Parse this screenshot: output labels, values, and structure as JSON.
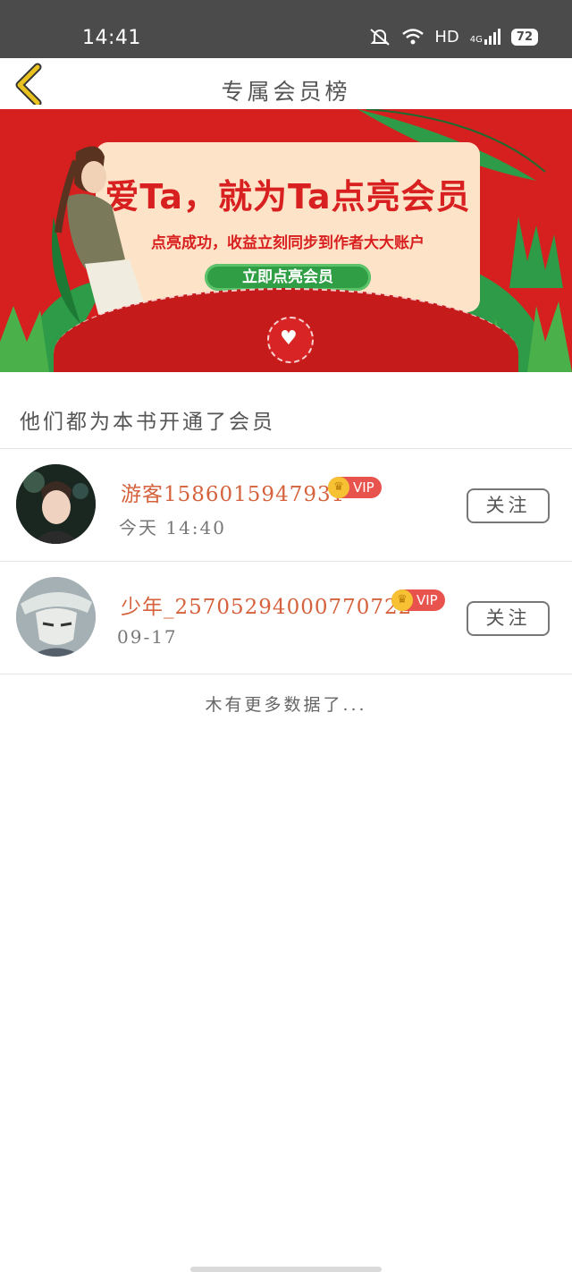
{
  "status_bar": {
    "time": "14:41",
    "network": "HD",
    "signal_type": "4G",
    "battery": "72"
  },
  "header": {
    "title": "专属会员榜"
  },
  "banner": {
    "headline": "爱Ta，就为Ta点亮会员",
    "subtext": "点亮成功，收益立刻同步到作者大大账户",
    "button_label": "立即点亮会员"
  },
  "section_title": "他们都为本书开通了会员",
  "members": [
    {
      "username": "游客15860159479​31",
      "badge": "VIP",
      "time": "今天 14:40",
      "follow_label": "关注"
    },
    {
      "username": "少年_25705294000770722",
      "badge": "VIP",
      "time": "09-17",
      "follow_label": "关注"
    }
  ],
  "footer_note": "木有更多数据了...",
  "colors": {
    "status_bar_bg": "#4b4b4b",
    "banner_red": "#d61f1f",
    "username_orange": "#d5623c",
    "vip_red": "#e8534e",
    "back_arrow": "#e9c21f"
  }
}
